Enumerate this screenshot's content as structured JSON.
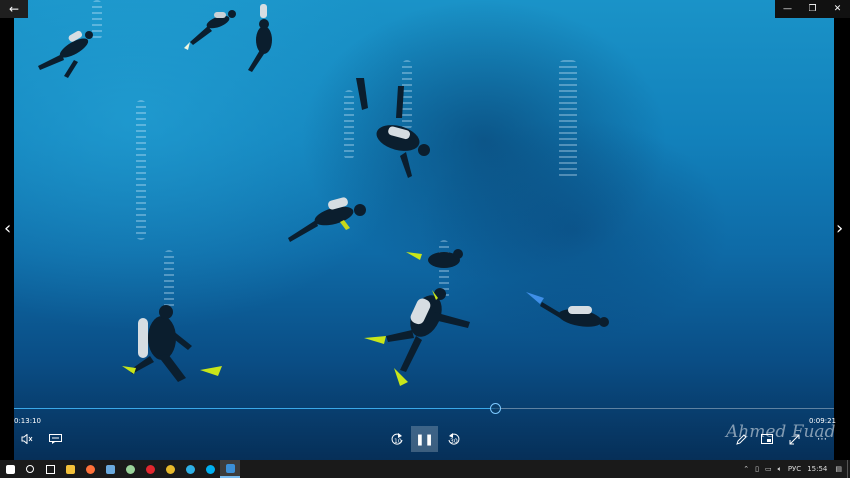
{
  "player": {
    "back_icon": "back-arrow-icon",
    "window_controls": [
      "minimize-icon",
      "restore-icon",
      "close-icon"
    ],
    "prev_icon": "chevron-left-icon",
    "next_icon": "chevron-right-icon",
    "elapsed": "0:13:10",
    "remaining": "0:09:21",
    "progress": 0.586,
    "skip_back_label": "10",
    "skip_forward_label": "30",
    "watermark": "Ahmed Fuad"
  },
  "taskbar": {
    "language": "РУС",
    "clock": "15:54",
    "apps": [
      {
        "icon": "windows-start-icon",
        "color": "#ffffff"
      },
      {
        "icon": "search-icon",
        "color": "#ffffff"
      },
      {
        "icon": "task-view-icon",
        "color": "#ffffff"
      },
      {
        "icon": "file-explorer-icon",
        "color": "#f3c13a"
      },
      {
        "icon": "firefox-icon",
        "color": "#ff7139"
      },
      {
        "icon": "photos-icon",
        "color": "#6aa9de"
      },
      {
        "icon": "chat-icon",
        "color": "#9ad39a"
      },
      {
        "icon": "opera-icon",
        "color": "#e2272e"
      },
      {
        "icon": "chrome-icon",
        "color": "#e8b92b"
      },
      {
        "icon": "edge-icon",
        "color": "#2eb0e6"
      },
      {
        "icon": "skype-icon",
        "color": "#00aff0"
      },
      {
        "icon": "media-player-icon",
        "color": "#3b8fd6"
      }
    ]
  }
}
